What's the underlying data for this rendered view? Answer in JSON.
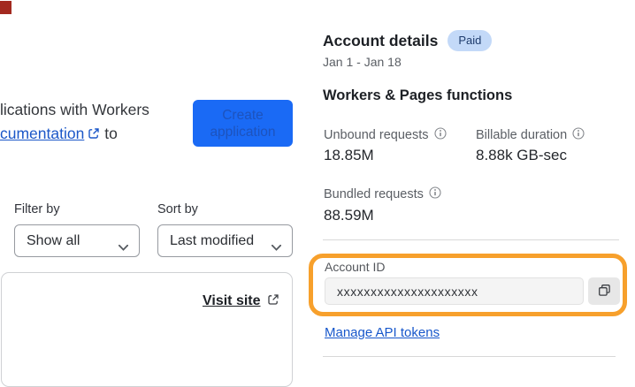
{
  "colors": {
    "accent_blue": "#1a6af5",
    "button_text_blue": "#1d53bd",
    "link_blue": "#1b57c8",
    "badge_bg": "#c3d9f8",
    "badge_text": "#1f3c6d",
    "highlight_orange": "#f7a02c",
    "corner_marker_red": "#a3291f"
  },
  "intro": {
    "line1": "lications with Workers",
    "link_text": "cumentation",
    "suffix": " to"
  },
  "create_button": {
    "line1": "Create",
    "line2": "application"
  },
  "filter": {
    "label": "Filter by",
    "value": "Show all"
  },
  "sort": {
    "label": "Sort by",
    "value": "Last modified"
  },
  "project_card": {
    "visit_site": "Visit site"
  },
  "account": {
    "title": "Account details",
    "badge": "Paid",
    "date_range": "Jan 1 - Jan 18",
    "section_title": "Workers & Pages functions",
    "stats": [
      {
        "label": "Unbound requests",
        "value": "18.85M"
      },
      {
        "label": "Billable duration",
        "value": "8.88k GB-sec"
      },
      {
        "label": "Bundled requests",
        "value": "88.59M"
      }
    ],
    "account_id_label": "Account ID",
    "account_id_value": "xxxxxxxxxxxxxxxxxxxxx",
    "manage_link": "Manage API tokens"
  }
}
